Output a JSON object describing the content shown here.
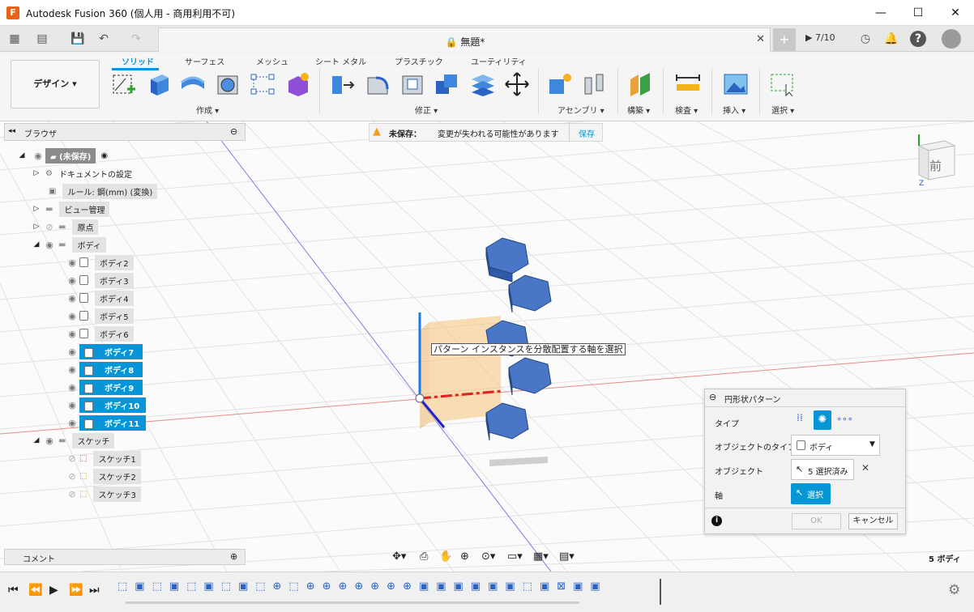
{
  "window": {
    "title": "Autodesk Fusion 360 (個人用 - 商用利用不可)",
    "min": "—",
    "max": "☐",
    "close": "✕"
  },
  "tabbar": {
    "doc_title": "無題*",
    "close": "✕",
    "job_count": "7/10"
  },
  "ribbon": {
    "workspace": "デザイン",
    "tabs": [
      "ソリッド",
      "サーフェス",
      "メッシュ",
      "シート メタル",
      "プラスチック",
      "ユーティリティ"
    ],
    "groups": [
      "作成",
      "修正",
      "アセンブリ",
      "構築",
      "検査",
      "挿入",
      "選択"
    ]
  },
  "browser": {
    "title": "ブラウザ",
    "root": "(未保存)",
    "items": {
      "doc_settings": "ドキュメントの設定",
      "rule": "ルール: 鋼(mm) (変換)",
      "view_mgmt": "ビュー管理",
      "origin": "原点",
      "bodies": "ボディ",
      "sketch": "スケッチ"
    },
    "bodies": [
      "ボディ2",
      "ボディ3",
      "ボディ4",
      "ボディ5",
      "ボディ6"
    ],
    "selected_bodies": [
      "ボディ7",
      "ボディ8",
      "ボディ9",
      "ボディ10",
      "ボディ11"
    ],
    "sketches": [
      "スケッチ1",
      "スケッチ2",
      "スケッチ3"
    ]
  },
  "warning": {
    "label": "未保存：",
    "message": "変更が失われる可能性があります",
    "save": "保存"
  },
  "tooltip": "パターン インスタンスを分散配置する軸を選択",
  "viewcube": {
    "face": "前",
    "z": "Z"
  },
  "comment": "コメント",
  "status": {
    "body_count": "5 ボディ"
  },
  "dialog": {
    "title": "円形状パターン",
    "type_label": "タイプ",
    "object_type_label": "オブジェクトのタイプ",
    "object_type_value": "ボディ",
    "object_label": "オブジェクト",
    "object_value": "5 選択済み",
    "axis_label": "軸",
    "axis_button": "選択",
    "ok": "OK",
    "cancel": "キャンセル"
  },
  "colors": {
    "accent": "#0696d7",
    "body_blue": "#3a66b8",
    "warning": "#f0a020"
  }
}
